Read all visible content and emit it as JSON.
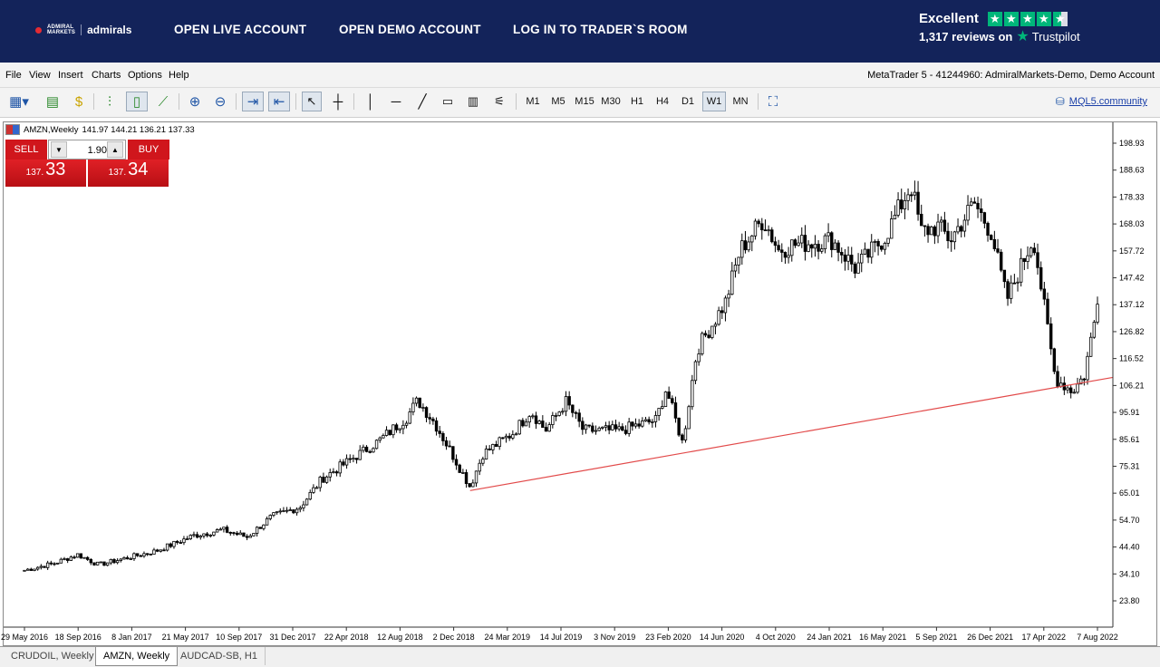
{
  "brand": {
    "logo_small_line1": "ADMIRAL",
    "logo_small_line2": "MARKETS",
    "logo_name": "admirals",
    "red": "#e32b33",
    "navy": "#13235a"
  },
  "nav": {
    "open_live": "OPEN LIVE ACCOUNT",
    "open_demo": "OPEN DEMO ACCOUNT",
    "login": "LOG IN TO TRADER`S ROOM"
  },
  "trustpilot": {
    "rating_word": "Excellent",
    "reviews": "1,317 reviews on",
    "brand": "Trustpilot",
    "star_color": "#00b67a"
  },
  "menu": {
    "items": [
      "File",
      "View",
      "Insert",
      "Charts",
      "Options",
      "Help"
    ],
    "title": "MetaTrader 5 - 41244960: AdmiralMarkets-Demo, Demo Account"
  },
  "toolbar": {
    "timeframes": [
      "M1",
      "M5",
      "M15",
      "M30",
      "H1",
      "H4",
      "D1",
      "W1",
      "MN"
    ],
    "active_timeframe": "W1",
    "community_link": "MQL5.community"
  },
  "symbol": {
    "name": "AMZN,Weekly",
    "ohlc": "141.97 144.21 136.21 137.33"
  },
  "trade": {
    "sell_label": "SELL",
    "buy_label": "BUY",
    "volume": "1.90",
    "sell_price_small": "137.",
    "sell_price_big": "33",
    "buy_price_small": "137.",
    "buy_price_big": "34"
  },
  "chart_data": {
    "type": "candlestick",
    "title": "",
    "y_ticks": [
      "198.93",
      "188.63",
      "178.33",
      "168.03",
      "157.72",
      "147.42",
      "137.12",
      "126.82",
      "116.52",
      "106.21",
      "95.91",
      "85.61",
      "75.31",
      "65.01",
      "54.70",
      "44.40",
      "34.10",
      "23.80"
    ],
    "x_ticks": [
      "29 May 2016",
      "18 Sep 2016",
      "8 Jan 2017",
      "21 May 2017",
      "10 Sep 2017",
      "31 Dec 2017",
      "22 Apr 2018",
      "12 Aug 2018",
      "2 Dec 2018",
      "24 Mar 2019",
      "14 Jul 2019",
      "3 Nov 2019",
      "23 Feb 2020",
      "14 Jun 2020",
      "4 Oct 2020",
      "24 Jan 2021",
      "16 May 2021",
      "5 Sep 2021",
      "26 Dec 2021",
      "17 Apr 2022",
      "7 Aug 2022"
    ],
    "ylim": [
      19.0,
      202.0
    ],
    "close_points": [
      [
        "2016-05-29",
        35.5
      ],
      [
        "2016-07-31",
        38.2
      ],
      [
        "2016-09-18",
        41.5
      ],
      [
        "2016-11-01",
        37.6
      ],
      [
        "2017-01-08",
        40.6
      ],
      [
        "2017-03-01",
        42.8
      ],
      [
        "2017-05-21",
        48.8
      ],
      [
        "2017-07-20",
        51.0
      ],
      [
        "2017-09-10",
        48.2
      ],
      [
        "2017-11-01",
        56.0
      ],
      [
        "2017-12-31",
        59.8
      ],
      [
        "2018-02-15",
        70.5
      ],
      [
        "2018-04-22",
        78.5
      ],
      [
        "2018-06-15",
        85.0
      ],
      [
        "2018-08-12",
        94.0
      ],
      [
        "2018-09-05",
        100.5
      ],
      [
        "2018-10-10",
        92.0
      ],
      [
        "2018-11-10",
        82.0
      ],
      [
        "2018-12-24",
        67.5
      ],
      [
        "2019-01-20",
        80.0
      ],
      [
        "2019-03-24",
        88.0
      ],
      [
        "2019-05-01",
        96.5
      ],
      [
        "2019-06-01",
        89.0
      ],
      [
        "2019-07-14",
        100.0
      ],
      [
        "2019-08-20",
        89.0
      ],
      [
        "2019-11-03",
        89.0
      ],
      [
        "2020-01-20",
        93.0
      ],
      [
        "2020-02-10",
        105.0
      ],
      [
        "2020-03-16",
        84.0
      ],
      [
        "2020-04-15",
        120.0
      ],
      [
        "2020-06-14",
        138.0
      ],
      [
        "2020-07-15",
        158.0
      ],
      [
        "2020-09-02",
        170.0
      ],
      [
        "2020-10-04",
        158.0
      ],
      [
        "2020-11-01",
        160.0
      ],
      [
        "2021-01-24",
        162.0
      ],
      [
        "2021-03-15",
        151.0
      ],
      [
        "2021-05-16",
        163.0
      ],
      [
        "2021-07-10",
        183.0
      ],
      [
        "2021-08-01",
        165.0
      ],
      [
        "2021-09-05",
        167.0
      ],
      [
        "2021-10-01",
        162.0
      ],
      [
        "2021-11-20",
        176.0
      ],
      [
        "2021-12-26",
        165.0
      ],
      [
        "2022-01-28",
        139.0
      ],
      [
        "2022-03-25",
        163.0
      ],
      [
        "2022-05-10",
        109.0
      ],
      [
        "2022-06-15",
        104.0
      ],
      [
        "2022-07-10",
        110.0
      ],
      [
        "2022-08-07",
        137.3
      ]
    ],
    "trendline": {
      "from": [
        "2018-12-24",
        66.0
      ],
      "to": [
        "2022-09-30",
        110.0
      ],
      "color": "#e24a4a"
    }
  },
  "tabs": [
    "CRUDOIL, Weekly",
    "AMZN, Weekly",
    "AUDCAD-SB, H1"
  ],
  "active_tab": "AMZN, Weekly"
}
